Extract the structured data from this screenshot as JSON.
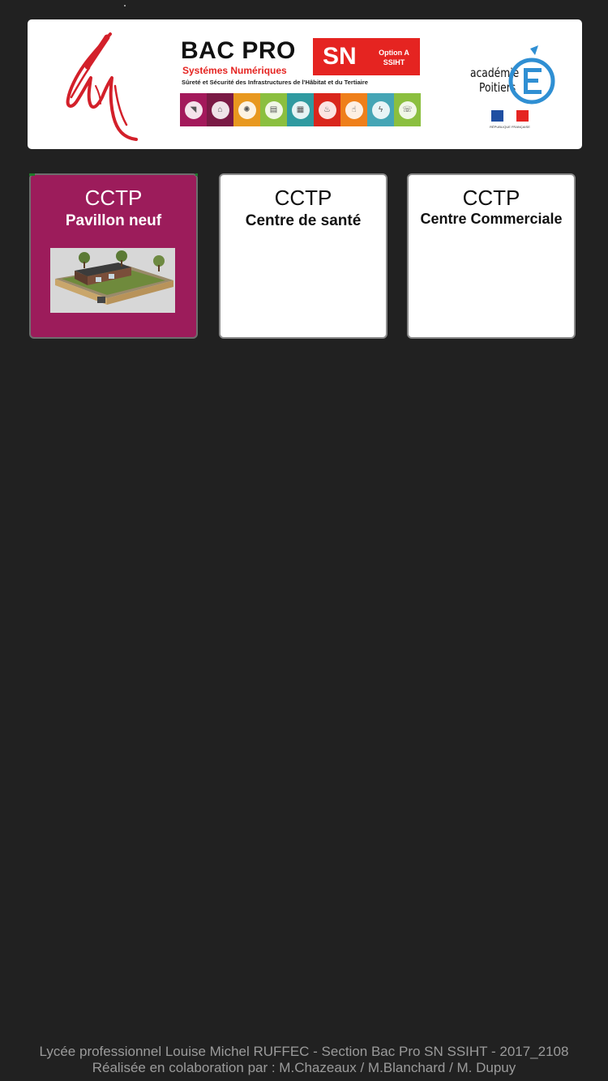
{
  "banner": {
    "bac_pro": "BAC PRO",
    "sn": "SN",
    "option": "Option A",
    "option_code": "SSIHT",
    "subtitle": "Systémes Numériques",
    "description": "Sûreté et Sécurité des Infrastructures de l'Hâbitat et du Tertiaire",
    "tile_colors": [
      "#a3195b",
      "#7a1a45",
      "#e8981f",
      "#8bbf3f",
      "#2f9aa0",
      "#d9261c",
      "#ef7f1a",
      "#45a5b5",
      "#8bbf3f"
    ],
    "academie_word": "académie",
    "poitiers_word": "Poitiers",
    "flag_caption": "RÉPUBLIQUE FRANÇAISE",
    "logo_color": "#d3202a",
    "academie_color": "#2f8fd3"
  },
  "cards": [
    {
      "title": "CCTP",
      "subtitle": "Pavillon neuf",
      "active": true
    },
    {
      "title": "CCTP",
      "subtitle": "Centre de santé",
      "active": false
    },
    {
      "title": "CCTP",
      "subtitle": "Centre Commerciale",
      "active": false
    }
  ],
  "footer": {
    "line1": "Lycée professionnel Louise Michel RUFFEC - Section Bac Pro SN SSIHT - 2017_2108",
    "line2": "Réalisée en colaboration par : M.Chazeaux / M.Blanchard / M. Dupuy"
  },
  "colors": {
    "background": "#212121",
    "active_card": "#9c1c5b",
    "card": "#ffffff",
    "footer_text": "#9b9b9b"
  }
}
